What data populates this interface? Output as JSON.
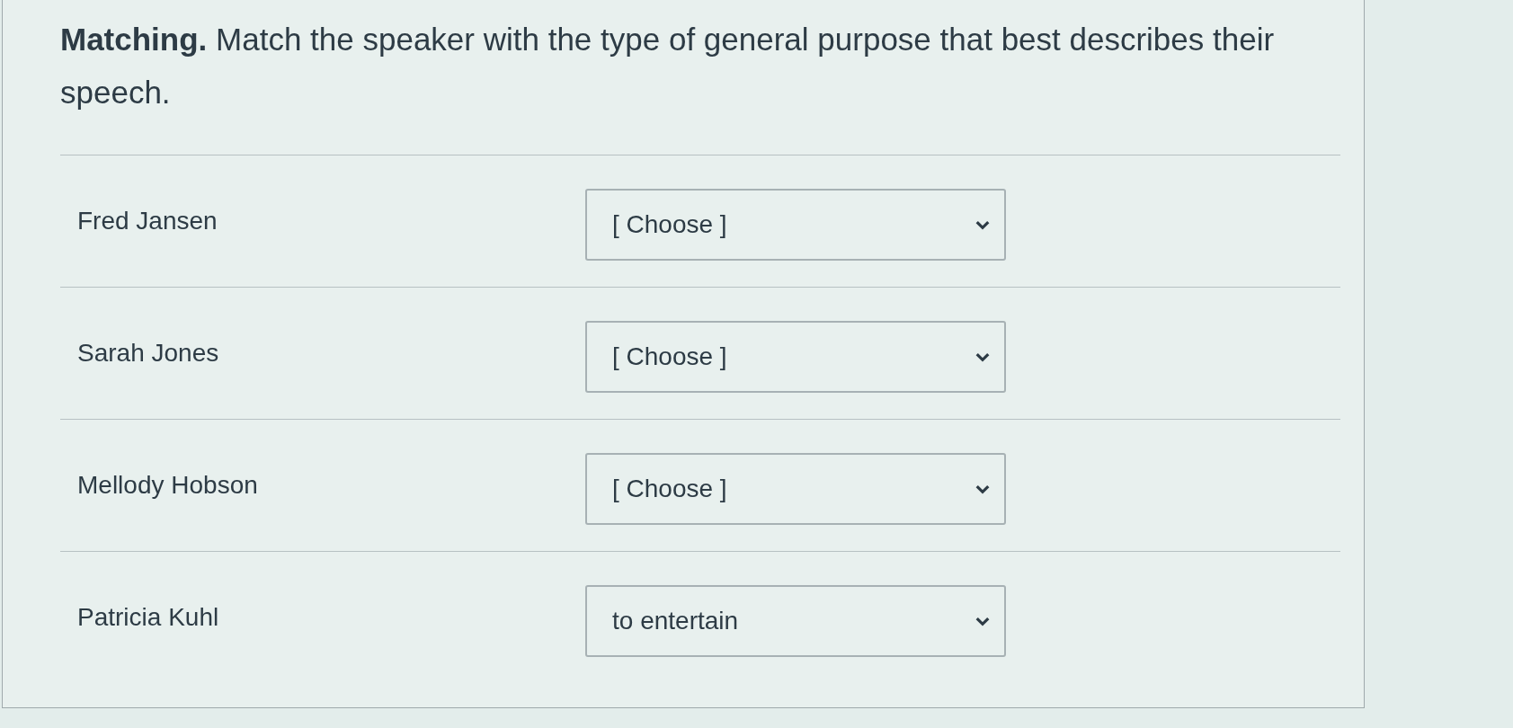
{
  "question": {
    "text": "**Matching.** Match the speaker with the type of general purpose that best describes their speech."
  },
  "pairs": [
    {
      "speaker": "Fred Jansen",
      "answer": "[ Choose ]"
    },
    {
      "speaker": "Sarah Jones",
      "answer": "[ Choose ]"
    },
    {
      "speaker": "Mellody Hobson",
      "answer": "[ Choose ]"
    },
    {
      "speaker": "Patricia Kuhl",
      "answer": "to entertain"
    }
  ]
}
